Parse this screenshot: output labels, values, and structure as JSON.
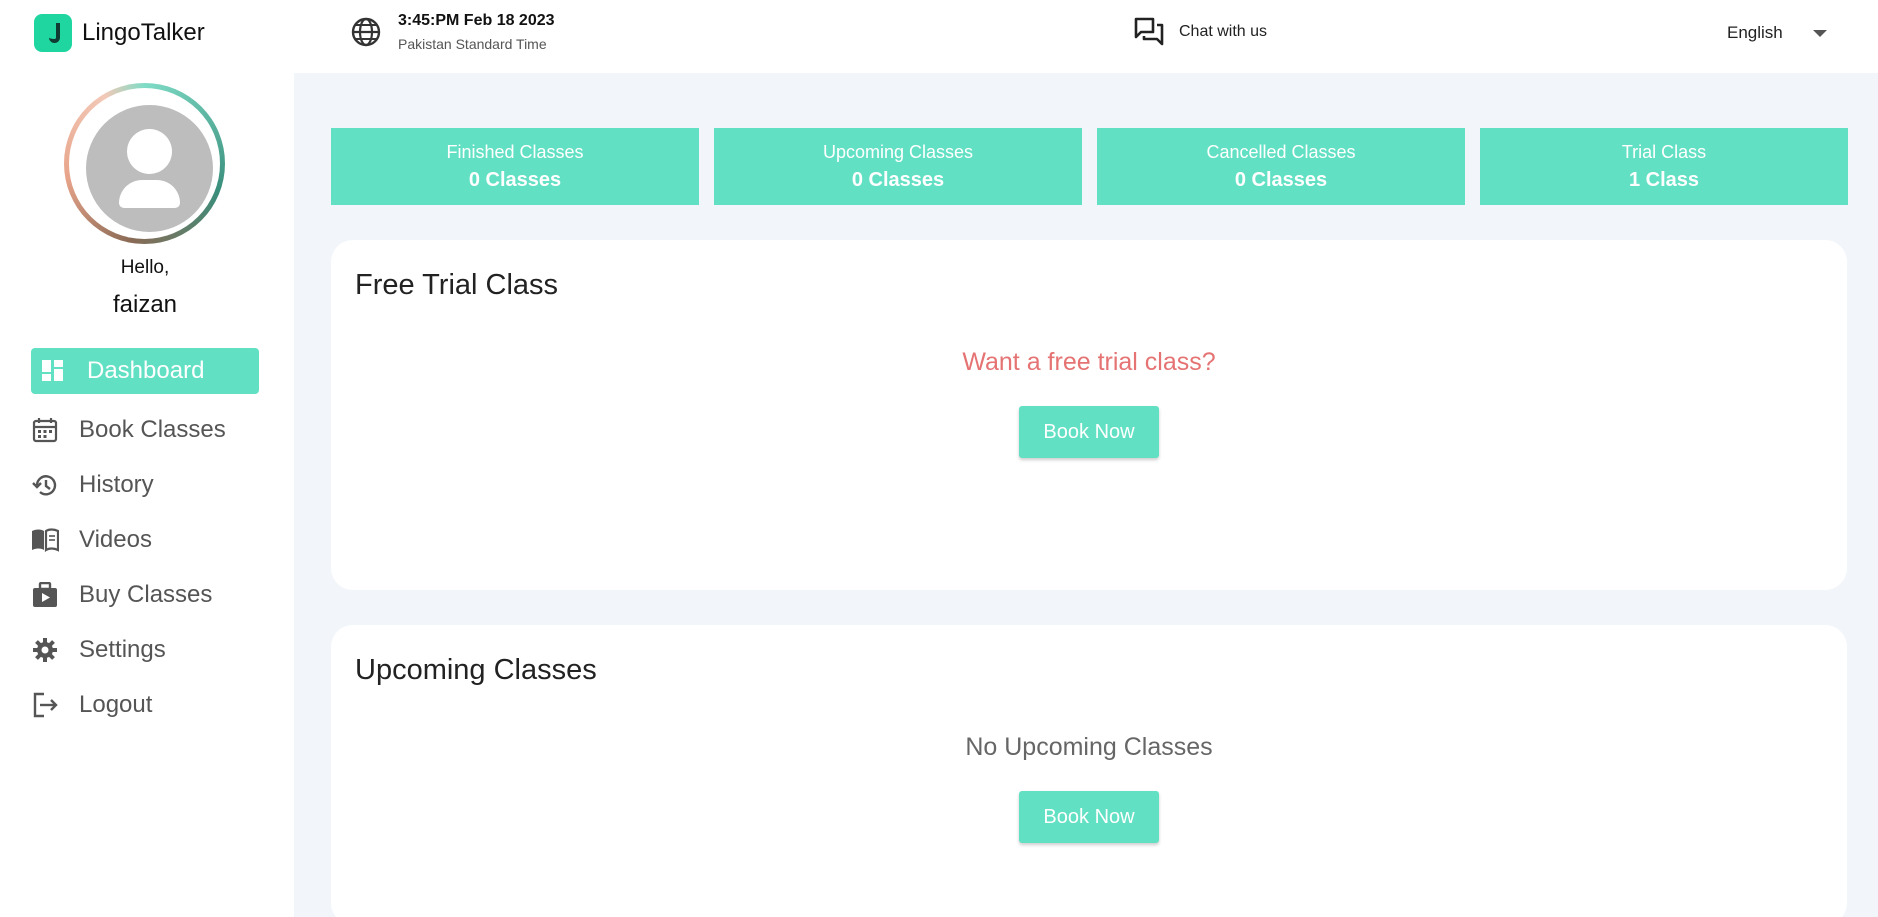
{
  "header": {
    "app_name": "LingoTalker",
    "time": "3:45:PM Feb 18 2023",
    "timezone": "Pakistan Standard Time",
    "chat_label": "Chat with us",
    "language": "English"
  },
  "sidebar": {
    "greeting": "Hello,",
    "username": "faizan",
    "items": [
      {
        "label": "Dashboard",
        "icon": "dashboard-icon",
        "active": true
      },
      {
        "label": "Book Classes",
        "icon": "calendar-icon",
        "active": false
      },
      {
        "label": "History",
        "icon": "history-icon",
        "active": false
      },
      {
        "label": "Videos",
        "icon": "book-icon",
        "active": false
      },
      {
        "label": "Buy Classes",
        "icon": "briefcase-play-icon",
        "active": false
      },
      {
        "label": "Settings",
        "icon": "gear-icon",
        "active": false
      },
      {
        "label": "Logout",
        "icon": "logout-icon",
        "active": false
      }
    ]
  },
  "stats": [
    {
      "label": "Finished Classes",
      "value": "0 Classes"
    },
    {
      "label": "Upcoming Classes",
      "value": "0 Classes"
    },
    {
      "label": "Cancelled Classes",
      "value": "0 Classes"
    },
    {
      "label": "Trial Class",
      "value": "1 Class"
    }
  ],
  "trial_card": {
    "title": "Free Trial Class",
    "question": "Want a free trial class?",
    "button": "Book Now"
  },
  "upcoming_card": {
    "title": "Upcoming Classes",
    "empty_text": "No Upcoming Classes",
    "button": "Book Now"
  },
  "colors": {
    "accent": "#62e0c3",
    "question": "#e57373",
    "main_bg": "#f2f6fa"
  }
}
